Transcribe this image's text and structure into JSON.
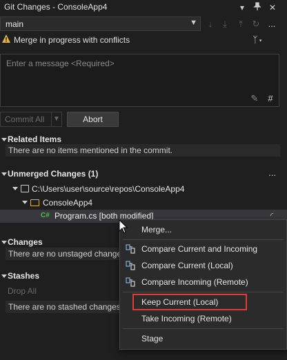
{
  "window": {
    "title": "Git Changes - ConsoleApp4"
  },
  "toolbar": {
    "title_icons": [
      "chevron-down-icon",
      "pin-icon",
      "close-icon"
    ],
    "branch": "main",
    "branch_more": "...",
    "git_icons": [
      "fetch-icon",
      "pull-icon",
      "push-icon",
      "sync-icon"
    ]
  },
  "status": {
    "warning": "Merge in progress with conflicts",
    "warning_color": "#e8b33a"
  },
  "commit": {
    "message_placeholder": "Enter a message <Required>",
    "commit_label": "Commit All",
    "abort_label": "Abort"
  },
  "sections": {
    "related": {
      "title": "Related Items",
      "empty": "There are no items mentioned in the commit."
    },
    "unmerged": {
      "title": "Unmerged Changes (1)",
      "more": "...",
      "repo_path": "C:\\Users\\user\\source\\repos\\ConsoleApp4",
      "folder": "ConsoleApp4",
      "file_badge": "C#",
      "file": "Program.cs [both modified]"
    },
    "changes": {
      "title": "Changes",
      "empty": "There are no unstaged changes."
    },
    "stashes": {
      "title": "Stashes",
      "drop_all": "Drop All",
      "empty": "There are no stashed changes."
    }
  },
  "context_menu": {
    "items": [
      {
        "label": "Merge...",
        "icon": ""
      },
      {
        "label": "Compare Current and Incoming",
        "icon": "compare-icon"
      },
      {
        "label": "Compare Current (Local)",
        "icon": "compare-icon"
      },
      {
        "label": "Compare Incoming (Remote)",
        "icon": "compare-icon"
      },
      {
        "label": "Keep Current (Local)",
        "icon": ""
      },
      {
        "label": "Take Incoming (Remote)",
        "icon": ""
      },
      {
        "label": "Stage",
        "icon": ""
      }
    ],
    "highlight_color": "#e33b3b"
  }
}
